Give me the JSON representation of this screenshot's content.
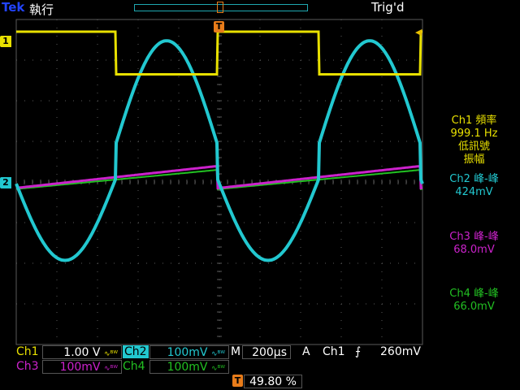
{
  "header": {
    "brand": "Tek",
    "run_state": "執行",
    "trigger_status": "Trig'd"
  },
  "markers": {
    "trigger_position": "T",
    "ch1": "1",
    "ch2": "2",
    "trigger_level": "◀"
  },
  "measurements": [
    {
      "title": "Ch1 頻率",
      "value": "999.1 Hz",
      "note1": "低訊號",
      "note2": "振幅"
    },
    {
      "title": "Ch2 峰-峰",
      "value": "424mV"
    },
    {
      "title": "Ch3 峰-峰",
      "value": "68.0mV"
    },
    {
      "title": "Ch4 峰-峰",
      "value": "66.0mV"
    }
  ],
  "channel_settings": {
    "ch1": {
      "label": "Ch1",
      "scale": "1.00 V",
      "bw": "∿ᴮᵂ"
    },
    "ch2": {
      "label": "Ch2",
      "scale": "100mV",
      "bw": "∿ᴮᵂ"
    },
    "ch3": {
      "label": "Ch3",
      "scale": "100mV",
      "bw": "∿ᴮᵂ"
    },
    "ch4": {
      "label": "Ch4",
      "scale": "100mV",
      "bw": "∿ᴮᵂ"
    }
  },
  "timebase": {
    "label": "M",
    "value": "200µs"
  },
  "trigger": {
    "mode": "A",
    "source": "Ch1",
    "slope": "⨍",
    "level": "260mV"
  },
  "trigger_position_percent": {
    "marker": "T",
    "value": "49.80 %"
  },
  "colors": {
    "ch1": "#e8e000",
    "ch2": "#22c8d0",
    "ch3": "#cc22cc",
    "ch4": "#22c022",
    "grid": "#5a5a5a",
    "trigger": "#e87c1a"
  },
  "display": {
    "h_divisions": 10,
    "v_divisions": 8,
    "period_divisions": 5.0,
    "ch1_high_div": 3.7,
    "ch1_low_div": 2.65,
    "ch2_offset_div": 0.0,
    "ch2_scale_mv_per_div": 100,
    "ch2_peak_to_peak_mv": 424,
    "ch3_peak_to_peak_mv": 68.0,
    "ch4_peak_to_peak_mv": 66.0
  }
}
